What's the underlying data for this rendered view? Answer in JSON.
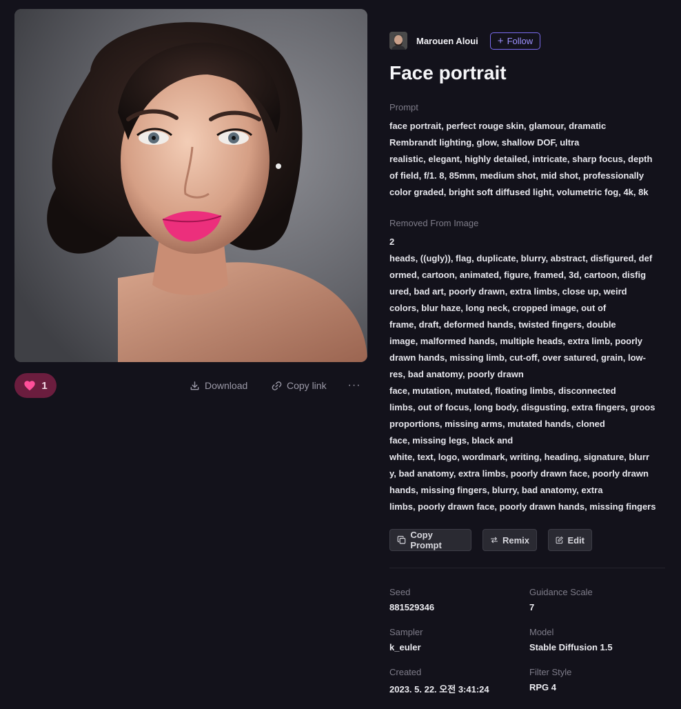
{
  "image": {
    "alt": "Face portrait"
  },
  "actions": {
    "like_count": "1",
    "download_label": "Download",
    "copy_link_label": "Copy link",
    "more_label": "···"
  },
  "author": {
    "name": "Marouen Aloui",
    "follow_label": "Follow"
  },
  "title": "Face portrait",
  "prompt": {
    "label": "Prompt",
    "lines": [
      "face portrait, perfect rouge skin, glamour, dramatic",
      "Rembrandt lighting, glow, shallow DOF, ultra",
      "realistic, elegant, highly detailed, intricate, sharp focus, depth",
      "of field, f/1. 8, 85mm, medium shot, mid shot, professionally",
      "color graded, bright soft diffused light, volumetric fog, 4k, 8k"
    ]
  },
  "removed": {
    "label": "Removed From Image",
    "lines": [
      "2",
      "heads, ((ugly)), flag, duplicate, blurry, abstract, disfigured, def",
      "ormed, cartoon, animated, figure, framed, 3d, cartoon, disfig",
      "ured, bad art, poorly drawn, extra limbs, close up, weird",
      "colors, blur haze, long neck, cropped image, out of",
      "frame, draft, deformed hands, twisted fingers, double",
      "image, malformed hands, multiple heads, extra limb, poorly",
      "drawn hands, missing limb, cut-off, over satured, grain, low-",
      "res, bad anatomy, poorly drawn",
      "face, mutation, mutated, floating limbs, disconnected",
      "limbs, out of focus, long body, disgusting, extra fingers, groos",
      "proportions, missing arms, mutated hands, cloned",
      "face, missing legs, black and",
      "white, text, logo, wordmark, writing, heading, signature, blurr",
      "y, bad anatomy, extra limbs, poorly drawn face, poorly drawn",
      "hands, missing fingers, blurry, bad anatomy, extra",
      "limbs, poorly drawn face, poorly drawn hands, missing fingers"
    ]
  },
  "buttons": {
    "copy_prompt": "Copy Prompt",
    "remix": "Remix",
    "edit": "Edit"
  },
  "meta": {
    "seed": {
      "label": "Seed",
      "value": "881529346"
    },
    "guidance": {
      "label": "Guidance Scale",
      "value": "7"
    },
    "sampler": {
      "label": "Sampler",
      "value": "k_euler"
    },
    "model": {
      "label": "Model",
      "value": "Stable Diffusion 1.5"
    },
    "created": {
      "label": "Created",
      "value": "2023. 5. 22. 오전 3:41:24"
    },
    "filter": {
      "label": "Filter Style",
      "value": "RPG 4"
    }
  },
  "colors": {
    "background": "#13121b",
    "accent": "#7b6cf0",
    "like_bg": "#6b1d3e",
    "like_heart": "#ff4f9a"
  }
}
